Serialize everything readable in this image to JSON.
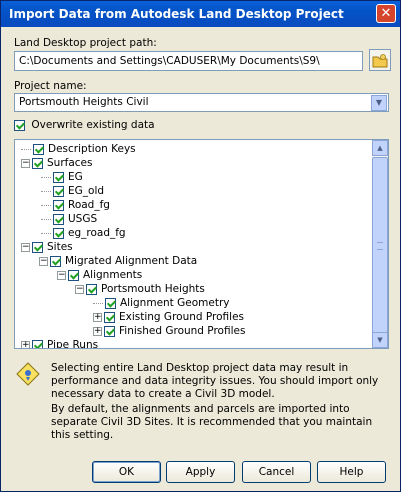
{
  "window": {
    "title": "Import Data from Autodesk Land Desktop Project",
    "close_glyph": "✕"
  },
  "path": {
    "label": "Land Desktop project path:",
    "value": "C:\\Documents and Settings\\CADUSER\\My Documents\\S9\\"
  },
  "project": {
    "label": "Project name:",
    "value": "Portsmouth Heights Civil"
  },
  "overwrite": {
    "label": "Overwrite existing data",
    "checked": true
  },
  "tree": {
    "n0": "Description Keys",
    "n1": "Surfaces",
    "n2": "EG",
    "n3": "EG_old",
    "n4": "Road_fg",
    "n5": "USGS",
    "n6": "eg_road_fg",
    "n7": "Sites",
    "n8": "Migrated Alignment Data",
    "n9": "Alignments",
    "n10": "Portsmouth Heights",
    "n11": "Alignment Geometry",
    "n12": "Existing Ground Profiles",
    "n13": "Finished Ground Profiles",
    "n14": "Pipe Runs",
    "expand_minus": "−",
    "expand_plus": "+"
  },
  "info": {
    "warning": "Selecting entire Land Desktop project data may result in performance and data integrity issues. You should import only necessary data to create a Civil 3D model.",
    "note": "By default, the alignments and parcels are imported into separate Civil 3D Sites.  It is recommended that you maintain this setting."
  },
  "buttons": {
    "ok": "OK",
    "apply": "Apply",
    "cancel": "Cancel",
    "help": "Help"
  },
  "colors": {
    "title_bar": "#0453c7",
    "dialog_bg": "#ece9d8",
    "check": "#21a121"
  }
}
